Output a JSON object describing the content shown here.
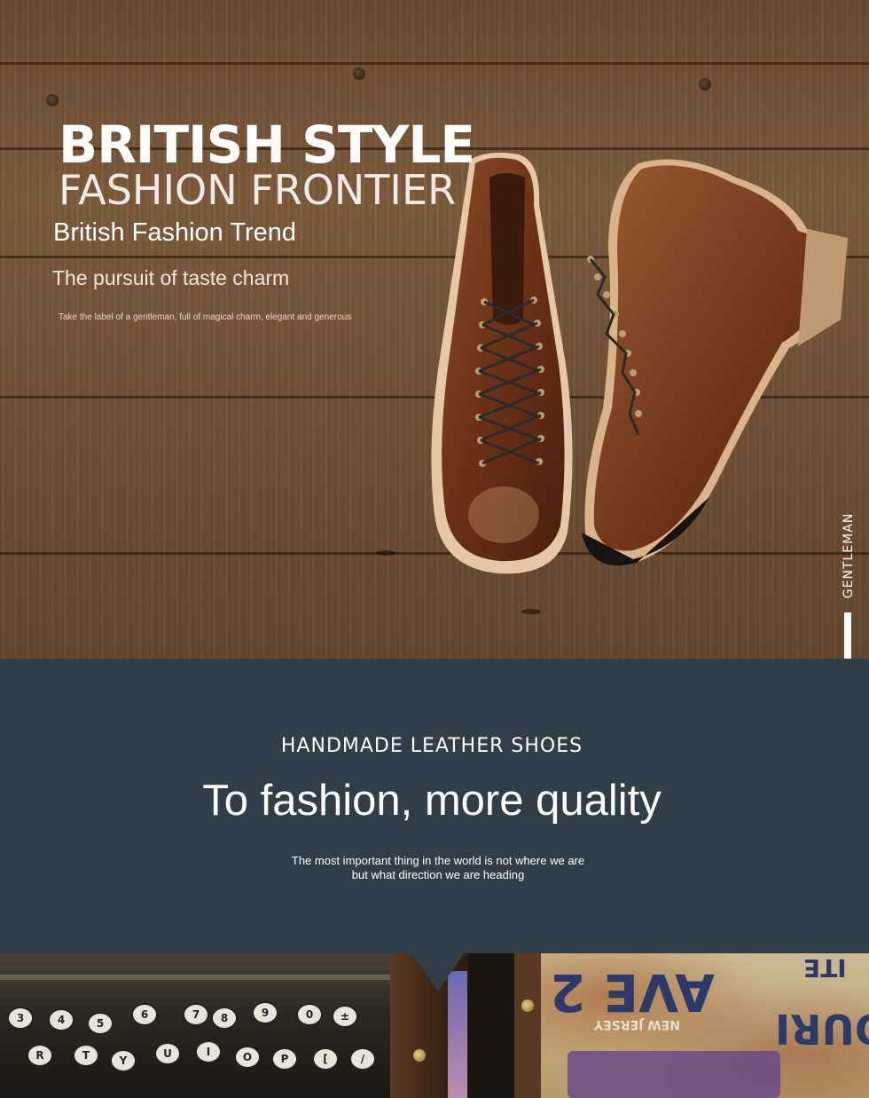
{
  "hero": {
    "title_line1": "BRITISH STYLE",
    "title_line2": "FASHION FRONTIER",
    "subtitle_line1": "British Fashion Trend",
    "subtitle_line2": "The pursuit of taste charm",
    "tagline": "Take the label of a gentleman, full of magical charm, elegant and generous",
    "vertical_label": "GENTLEMAN"
  },
  "band": {
    "heading": "HANDMADE LEATHER SHOES",
    "main": "To fashion, more quality",
    "line1": "The most important thing in the world is not where we are",
    "line2": "but what direction we are heading"
  },
  "strip": {
    "keys_row1": [
      "3",
      "4",
      "5",
      "6",
      "7",
      "8",
      "9",
      "0",
      "±"
    ],
    "keys_row2": [
      "R",
      "T",
      "Y",
      "U",
      "I",
      "O",
      "P",
      "[",
      "/"
    ],
    "sign_word1": "AVE 2",
    "sign_word2": "NEW JERSEY",
    "sign_word3": "OURI",
    "sign_word4": "ITE"
  },
  "colors": {
    "band_bg": "#313d47",
    "wood": "#7c5a3c",
    "leather": "#7a3a1e"
  }
}
